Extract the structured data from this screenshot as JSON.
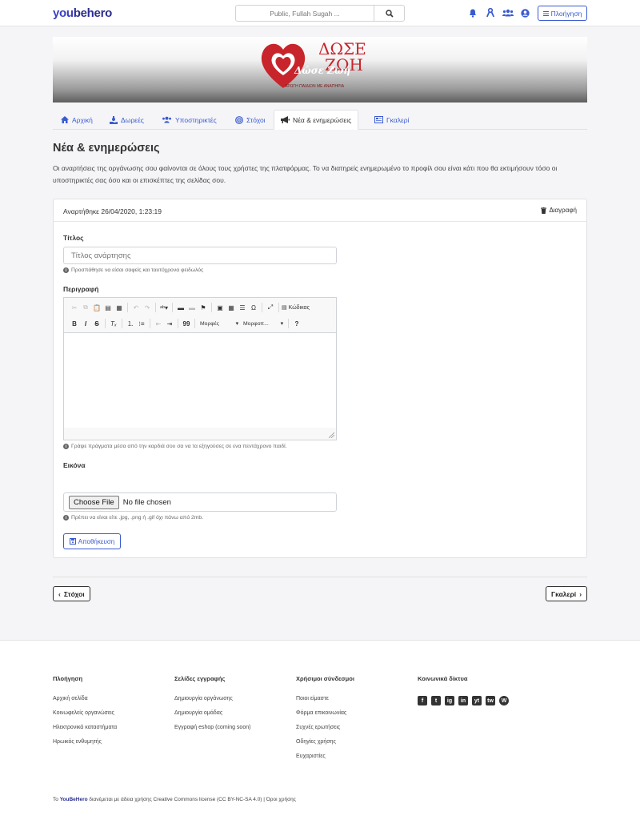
{
  "header": {
    "logo_prefix": "you",
    "logo_suffix": "behero",
    "search_placeholder": "Public, Fullah Sugah ...",
    "nav_button": "Πλοήγηση",
    "icons": [
      "bell-icon",
      "ribbon-icon",
      "users-icon",
      "user-circle-icon"
    ]
  },
  "banner": {
    "title_top": "ΔΩΣΕ",
    "title_bottom": "ΖΩΗ",
    "script_text": "Δώσε Ζωή",
    "tagline": "ΑΡΩΓΗ ΠΑΙΔΙΩΝ ΜΕ ΑΝΑΠΗΡΙΑ"
  },
  "tabs": [
    {
      "label": "Αρχική",
      "icon": "home-icon"
    },
    {
      "label": "Δωρεές",
      "icon": "donate-icon"
    },
    {
      "label": "Υποστηρικτές",
      "icon": "users-icon"
    },
    {
      "label": "Στόχοι",
      "icon": "target-icon"
    },
    {
      "label": "Νέα & ενημερώσεις",
      "icon": "megaphone-icon",
      "active": true
    },
    {
      "label": "Γκαλερί",
      "icon": "gallery-icon"
    }
  ],
  "page": {
    "title": "Νέα & ενημερώσεις",
    "intro": "Οι αναρτήσεις της οργάνωσης σου φαίνονται σε όλους τους χρήστες της πλατφόρμας. Το να διατηρείς ενημερωμένο το προφίλ σου είναι κάτι που θα εκτιμήσουν τόσο οι υποστηρικτές σας όσο και οι επισκέπτες της σελίδας σου."
  },
  "post": {
    "posted": "Αναρτήθηκε 26/04/2020, 1:23:19",
    "delete_label": "Διαγραφή",
    "title_label": "Τίτλος",
    "title_placeholder": "Τίτλος ανάρτησης",
    "title_hint": "Προσπάθησε να είσαι σαφείς και ταυτόχρονα φειδωλός",
    "description_label": "Περιγραφή",
    "description_hint": "Γράψε πράγματα μέσα από την καρδιά σου σα να τα εξηγούσες σε ενα πεντάχρονο παιδί.",
    "image_label": "Εικόνα",
    "choose_file": "Choose File",
    "no_file": "No file chosen",
    "image_hint": "Πρέπει να είναι είτε .jpg, .png ή .gif όχι πάνω από 2mb.",
    "save_label": "Αποθήκευση"
  },
  "editor": {
    "source_label": "Κώδικας",
    "styles_label": "Μορφές",
    "format_label": "Μορφοπ...",
    "bold": "B",
    "italic": "I",
    "strike": "S",
    "quote": "99",
    "help": "?"
  },
  "pager": {
    "prev": "Στόχοι",
    "next": "Γκαλερί"
  },
  "footer": {
    "columns": [
      {
        "title": "Πλοήγηση",
        "links": [
          "Αρχική σελίδα",
          "Κοινωφελείς οργανώσεις",
          "Ηλεκτρονικά καταστήματα",
          "Ηρωικός ενθυμητής"
        ]
      },
      {
        "title": "Σελίδες εγγραφής",
        "links": [
          "Δημιουργία οργάνωσης",
          "Δημιουργία ομάδας",
          "Εγγραφή eshop (coming soon)"
        ]
      },
      {
        "title": "Χρήσιμοι σύνδεσμοι",
        "links": [
          "Ποιοι είμαστε",
          "Φόρμα επικοινωνίας",
          "Συχνές ερωτήσεις",
          "Οδηγίες χρήσης",
          "Ευχαριστίες"
        ]
      }
    ],
    "social_title": "Κοινωνικά δίκτυα",
    "social": [
      "f",
      "t",
      "ig",
      "in",
      "yt",
      "tw",
      "W"
    ],
    "copy_prefix": "Το ",
    "copy_brand": "YouBeHero",
    "copy_rest": " διανέμεται με άδεια χρήσης Creative Commons license (CC BY-NC-SA 4.0) | Όροι χρήσης"
  }
}
